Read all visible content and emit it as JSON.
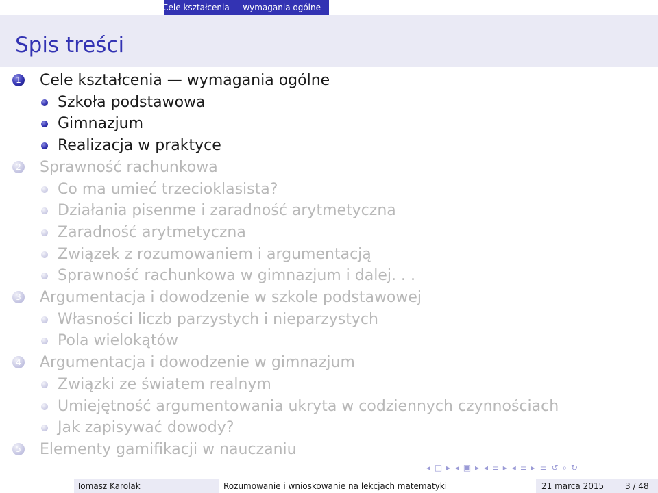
{
  "header": {
    "section_label": "Cele kształcenia — wymagania ogólne"
  },
  "title": "Spis treści",
  "toc": {
    "sections": [
      {
        "number": "1",
        "label": "Cele kształcenia — wymagania ogólne",
        "active": true,
        "items": [
          "Szkoła podstawowa",
          "Gimnazjum",
          "Realizacja w praktyce"
        ]
      },
      {
        "number": "2",
        "label": "Sprawność rachunkowa",
        "active": false,
        "items": [
          "Co ma umieć trzecioklasista?",
          "Działania pisenme i zaradność arytmetyczna",
          "Zaradność arytmetyczna",
          "Związek z rozumowaniem i argumentacją",
          "Sprawność rachunkowa w gimnazjum i dalej. . ."
        ]
      },
      {
        "number": "3",
        "label": "Argumentacja i dowodzenie w szkole podstawowej",
        "active": false,
        "items": [
          "Własności liczb parzystych i nieparzystych",
          "Pola wielokątów"
        ]
      },
      {
        "number": "4",
        "label": "Argumentacja i dowodzenie w gimnazjum",
        "active": false,
        "items": [
          "Związki ze światem realnym",
          "Umiejętność argumentowania ukryta w codziennych czynnościach",
          "Jak zapisywać dowody?"
        ]
      },
      {
        "number": "5",
        "label": "Elementy gamifikacji w nauczaniu",
        "active": false,
        "items": []
      }
    ]
  },
  "nav_symbols": [
    "◂ □ ▸",
    "◂ ▣ ▸",
    "◂ ≡ ▸",
    "◂ ≡ ▸",
    "≡",
    "↺ ⌕ ↻"
  ],
  "footer": {
    "author": "Tomasz Karolak",
    "talk_title": "Rozumowanie i wnioskowanie na lekcjach matematyki",
    "date": "21 marca 2015",
    "page": "3 / 48"
  },
  "colors": {
    "accent": "#3333b3",
    "title_bg": "#eaeaf5",
    "faded_text": "#b8b8b8"
  }
}
